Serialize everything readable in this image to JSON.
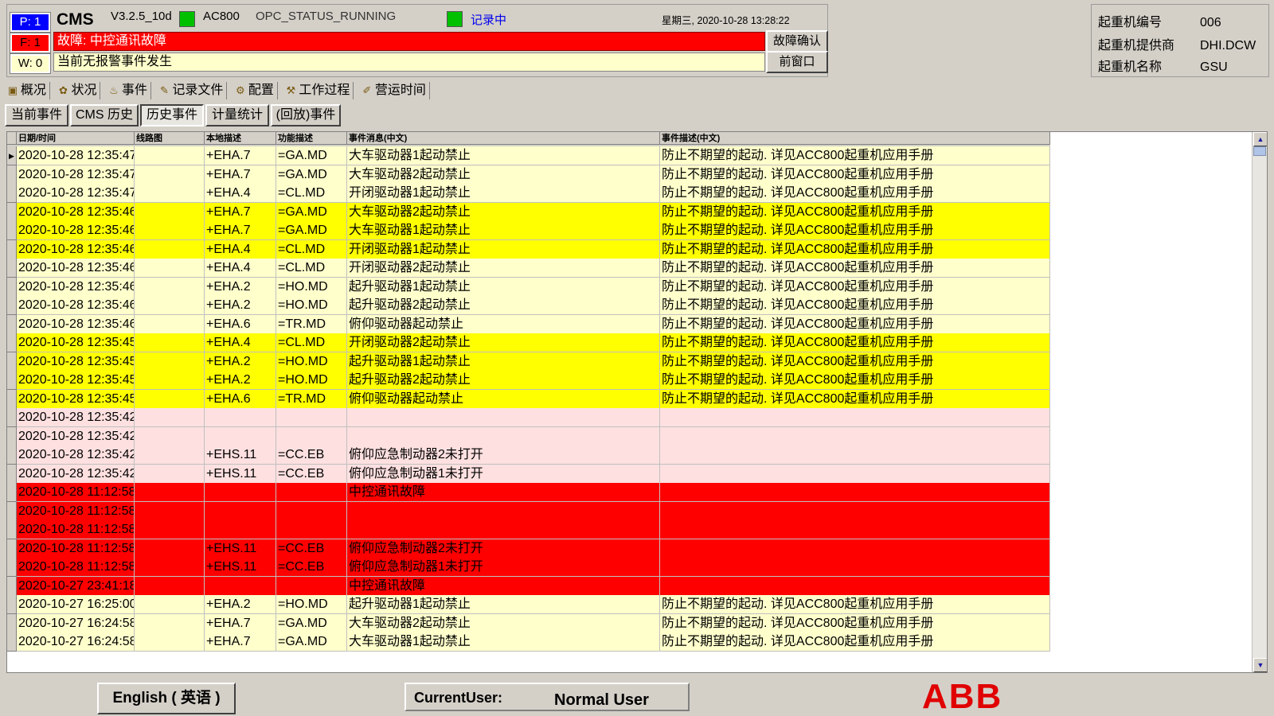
{
  "header": {
    "p_badge": "P: 1",
    "f_badge": "F: 1",
    "w_badge": "W: 0",
    "app": "CMS",
    "version": "V3.2.5_10d",
    "plc": "AC800",
    "opc_status": "OPC_STATUS_RUNNING",
    "recording": "记录中",
    "datetime": "星期三, 2020-10-28   13:28:22",
    "fault_text": "故障: 中控通讯故障",
    "warn_text": "当前无报警事件发生",
    "ack_button": "故障确认",
    "prev_window_button": "前窗口",
    "status_color": "#00c000",
    "fault_color": "#ff0000"
  },
  "crane": {
    "number_label": "起重机编号",
    "number_value": "006",
    "supplier_label": "起重机提供商",
    "supplier_value": "DHI.DCW",
    "name_label": "起重机名称",
    "name_value": "GSU"
  },
  "tabs": [
    {
      "label": "概况",
      "icon": "overview-icon"
    },
    {
      "label": "状况",
      "icon": "status-icon"
    },
    {
      "label": "事件",
      "icon": "events-icon"
    },
    {
      "label": "记录文件",
      "icon": "record-file-icon"
    },
    {
      "label": "配置",
      "icon": "config-icon"
    },
    {
      "label": "工作过程",
      "icon": "work-process-icon"
    },
    {
      "label": "营运时间",
      "icon": "operating-time-icon"
    }
  ],
  "subtabs": [
    "当前事件",
    "CMS 历史",
    "历史事件",
    "计量统计",
    "(回放)事件"
  ],
  "grid": {
    "columns": [
      "日期/时间",
      "线路图",
      "本地描述",
      "功能描述",
      "事件消息(中文)",
      "事件描述(中文)"
    ],
    "rows": [
      {
        "c": "cream",
        "t": "2020-10-28 12:35:47",
        "l": "+EHA.7",
        "f": "=GA.MD",
        "m": "大车驱动器1起动禁止",
        "d": "防止不期望的起动. 详见ACC800起重机应用手册"
      },
      {
        "c": "cream",
        "t": "2020-10-28 12:35:47",
        "l": "+EHA.7",
        "f": "=GA.MD",
        "m": "大车驱动器2起动禁止",
        "d": "防止不期望的起动. 详见ACC800起重机应用手册"
      },
      {
        "c": "cream",
        "t": "2020-10-28 12:35:47",
        "l": "+EHA.4",
        "f": "=CL.MD",
        "m": "开闭驱动器1起动禁止",
        "d": "防止不期望的起动. 详见ACC800起重机应用手册"
      },
      {
        "c": "yellow",
        "t": "2020-10-28 12:35:46",
        "l": "+EHA.7",
        "f": "=GA.MD",
        "m": "大车驱动器2起动禁止",
        "d": "防止不期望的起动. 详见ACC800起重机应用手册"
      },
      {
        "c": "yellow",
        "t": "2020-10-28 12:35:46",
        "l": "+EHA.7",
        "f": "=GA.MD",
        "m": "大车驱动器1起动禁止",
        "d": "防止不期望的起动. 详见ACC800起重机应用手册"
      },
      {
        "c": "yellow",
        "t": "2020-10-28 12:35:46",
        "l": "+EHA.4",
        "f": "=CL.MD",
        "m": "开闭驱动器1起动禁止",
        "d": "防止不期望的起动. 详见ACC800起重机应用手册"
      },
      {
        "c": "cream",
        "t": "2020-10-28 12:35:46",
        "l": "+EHA.4",
        "f": "=CL.MD",
        "m": "开闭驱动器2起动禁止",
        "d": "防止不期望的起动. 详见ACC800起重机应用手册"
      },
      {
        "c": "cream",
        "t": "2020-10-28 12:35:46",
        "l": "+EHA.2",
        "f": "=HO.MD",
        "m": "起升驱动器1起动禁止",
        "d": "防止不期望的起动. 详见ACC800起重机应用手册"
      },
      {
        "c": "cream",
        "t": "2020-10-28 12:35:46",
        "l": "+EHA.2",
        "f": "=HO.MD",
        "m": "起升驱动器2起动禁止",
        "d": "防止不期望的起动. 详见ACC800起重机应用手册"
      },
      {
        "c": "cream",
        "t": "2020-10-28 12:35:46",
        "l": "+EHA.6",
        "f": "=TR.MD",
        "m": "俯仰驱动器起动禁止",
        "d": "防止不期望的起动. 详见ACC800起重机应用手册"
      },
      {
        "c": "yellow",
        "t": "2020-10-28 12:35:45",
        "l": "+EHA.4",
        "f": "=CL.MD",
        "m": "开闭驱动器2起动禁止",
        "d": "防止不期望的起动. 详见ACC800起重机应用手册"
      },
      {
        "c": "yellow",
        "t": "2020-10-28 12:35:45",
        "l": "+EHA.2",
        "f": "=HO.MD",
        "m": "起升驱动器1起动禁止",
        "d": "防止不期望的起动. 详见ACC800起重机应用手册"
      },
      {
        "c": "yellow",
        "t": "2020-10-28 12:35:45",
        "l": "+EHA.2",
        "f": "=HO.MD",
        "m": "起升驱动器2起动禁止",
        "d": "防止不期望的起动. 详见ACC800起重机应用手册"
      },
      {
        "c": "yellow",
        "t": "2020-10-28 12:35:45",
        "l": "+EHA.6",
        "f": "=TR.MD",
        "m": "俯仰驱动器起动禁止",
        "d": "防止不期望的起动. 详见ACC800起重机应用手册"
      },
      {
        "c": "pink",
        "t": "2020-10-28 12:35:42",
        "l": "",
        "f": "",
        "m": "",
        "d": ""
      },
      {
        "c": "pink",
        "t": "2020-10-28 12:35:42",
        "l": "",
        "f": "",
        "m": "",
        "d": ""
      },
      {
        "c": "pink",
        "t": "2020-10-28 12:35:42",
        "l": "+EHS.11",
        "f": "=CC.EB",
        "m": "俯仰应急制动器2未打开",
        "d": ""
      },
      {
        "c": "pink",
        "t": "2020-10-28 12:35:42",
        "l": "+EHS.11",
        "f": "=CC.EB",
        "m": "俯仰应急制动器1未打开",
        "d": ""
      },
      {
        "c": "red",
        "t": "2020-10-28 11:12:58",
        "l": "",
        "f": "",
        "m": "中控通讯故障",
        "d": ""
      },
      {
        "c": "red",
        "t": "2020-10-28 11:12:58",
        "l": "",
        "f": "",
        "m": "",
        "d": ""
      },
      {
        "c": "red",
        "t": "2020-10-28 11:12:58",
        "l": "",
        "f": "",
        "m": "",
        "d": ""
      },
      {
        "c": "red",
        "t": "2020-10-28 11:12:58",
        "l": "+EHS.11",
        "f": "=CC.EB",
        "m": "俯仰应急制动器2未打开",
        "d": ""
      },
      {
        "c": "red",
        "t": "2020-10-28 11:12:58",
        "l": "+EHS.11",
        "f": "=CC.EB",
        "m": "俯仰应急制动器1未打开",
        "d": ""
      },
      {
        "c": "red",
        "t": "2020-10-27 23:41:18",
        "l": "",
        "f": "",
        "m": "中控通讯故障",
        "d": ""
      },
      {
        "c": "cream",
        "t": "2020-10-27 16:25:00",
        "l": "+EHA.2",
        "f": "=HO.MD",
        "m": "起升驱动器1起动禁止",
        "d": "防止不期望的起动. 详见ACC800起重机应用手册"
      },
      {
        "c": "cream",
        "t": "2020-10-27 16:24:58",
        "l": "+EHA.7",
        "f": "=GA.MD",
        "m": "大车驱动器2起动禁止",
        "d": "防止不期望的起动. 详见ACC800起重机应用手册"
      },
      {
        "c": "cream",
        "t": "2020-10-27 16:24:58",
        "l": "+EHA.7",
        "f": "=GA.MD",
        "m": "大车驱动器1起动禁止",
        "d": "防止不期望的起动. 详见ACC800起重机应用手册"
      }
    ]
  },
  "footer": {
    "language_button": "English ( 英语 )",
    "user_label": "CurrentUser:",
    "user_value": "Normal User",
    "logo": "ABB"
  }
}
